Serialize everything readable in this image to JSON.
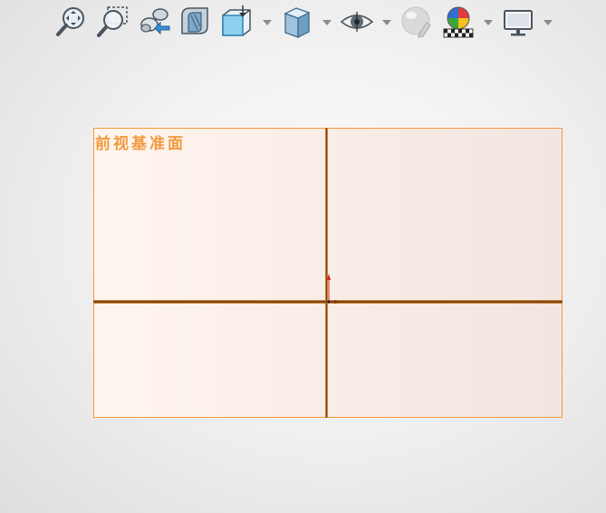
{
  "toolbar": {
    "icons": [
      "zoom-to-fit-icon",
      "zoom-to-area-icon",
      "previous-view-icon",
      "section-view-icon",
      "view-orientation-icon",
      "display-style-icon",
      "hide-show-items-icon",
      "edit-appearance-icon",
      "apply-scene-icon",
      "view-settings-icon"
    ]
  },
  "viewport": {
    "plane_label": "前视基准面"
  },
  "colors": {
    "plane_border": "#f39a3a",
    "plane_label": "#f29a3c",
    "axis_dark": "#6b3a10",
    "origin_red": "#e02020"
  }
}
